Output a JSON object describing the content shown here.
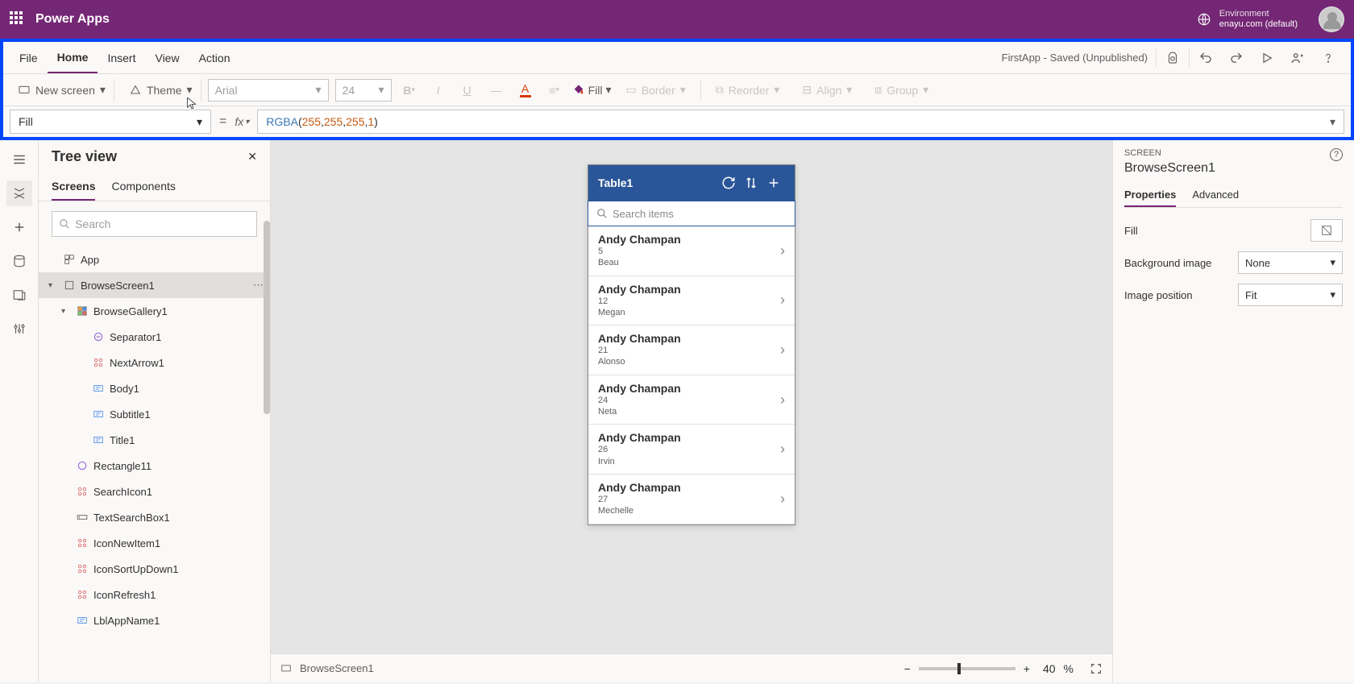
{
  "header": {
    "app": "Power Apps",
    "env_label": "Environment",
    "env_name": "enayu.com (default)"
  },
  "menu": {
    "items": [
      "File",
      "Home",
      "Insert",
      "View",
      "Action"
    ],
    "active": "Home",
    "status": "FirstApp - Saved (Unpublished)"
  },
  "toolbar": {
    "newscreen": "New screen",
    "theme": "Theme",
    "font": "Arial",
    "size": "24",
    "fill": "Fill",
    "border": "Border",
    "reorder": "Reorder",
    "align": "Align",
    "group": "Group"
  },
  "formula": {
    "property": "Fill",
    "fn": "RGBA",
    "args": "(255, 255, 255, 1)"
  },
  "tree": {
    "title": "Tree view",
    "tabs": [
      "Screens",
      "Components"
    ],
    "active_tab": "Screens",
    "search_placeholder": "Search",
    "nodes": [
      {
        "label": "App",
        "indent": 0,
        "icon": "app",
        "expand": ""
      },
      {
        "label": "BrowseScreen1",
        "indent": 0,
        "icon": "screen",
        "expand": "▾",
        "selected": true,
        "more": true
      },
      {
        "label": "BrowseGallery1",
        "indent": 1,
        "icon": "gallery",
        "expand": "▾"
      },
      {
        "label": "Separator1",
        "indent": 2,
        "icon": "sep"
      },
      {
        "label": "NextArrow1",
        "indent": 2,
        "icon": "arrow"
      },
      {
        "label": "Body1",
        "indent": 2,
        "icon": "label"
      },
      {
        "label": "Subtitle1",
        "indent": 2,
        "icon": "label"
      },
      {
        "label": "Title1",
        "indent": 2,
        "icon": "label"
      },
      {
        "label": "Rectangle11",
        "indent": 1,
        "icon": "rect"
      },
      {
        "label": "SearchIcon1",
        "indent": 1,
        "icon": "arrow"
      },
      {
        "label": "TextSearchBox1",
        "indent": 1,
        "icon": "input"
      },
      {
        "label": "IconNewItem1",
        "indent": 1,
        "icon": "arrow"
      },
      {
        "label": "IconSortUpDown1",
        "indent": 1,
        "icon": "arrow"
      },
      {
        "label": "IconRefresh1",
        "indent": 1,
        "icon": "arrow"
      },
      {
        "label": "LblAppName1",
        "indent": 1,
        "icon": "label"
      }
    ]
  },
  "phone": {
    "title": "Table1",
    "search": "Search items",
    "items": [
      {
        "title": "Andy Champan",
        "num": "5",
        "name": "Beau"
      },
      {
        "title": "Andy Champan",
        "num": "12",
        "name": "Megan"
      },
      {
        "title": "Andy Champan",
        "num": "21",
        "name": "Alonso"
      },
      {
        "title": "Andy Champan",
        "num": "24",
        "name": "Neta"
      },
      {
        "title": "Andy Champan",
        "num": "26",
        "name": "Irvin"
      },
      {
        "title": "Andy Champan",
        "num": "27",
        "name": "Mechelle"
      }
    ]
  },
  "footer": {
    "screen": "BrowseScreen1",
    "zoom": "40",
    "pct": "%"
  },
  "props": {
    "label": "SCREEN",
    "name": "BrowseScreen1",
    "tabs": [
      "Properties",
      "Advanced"
    ],
    "active": "Properties",
    "rows": {
      "fill": "Fill",
      "bgimg": "Background image",
      "bgimg_val": "None",
      "imgpos": "Image position",
      "imgpos_val": "Fit"
    }
  }
}
